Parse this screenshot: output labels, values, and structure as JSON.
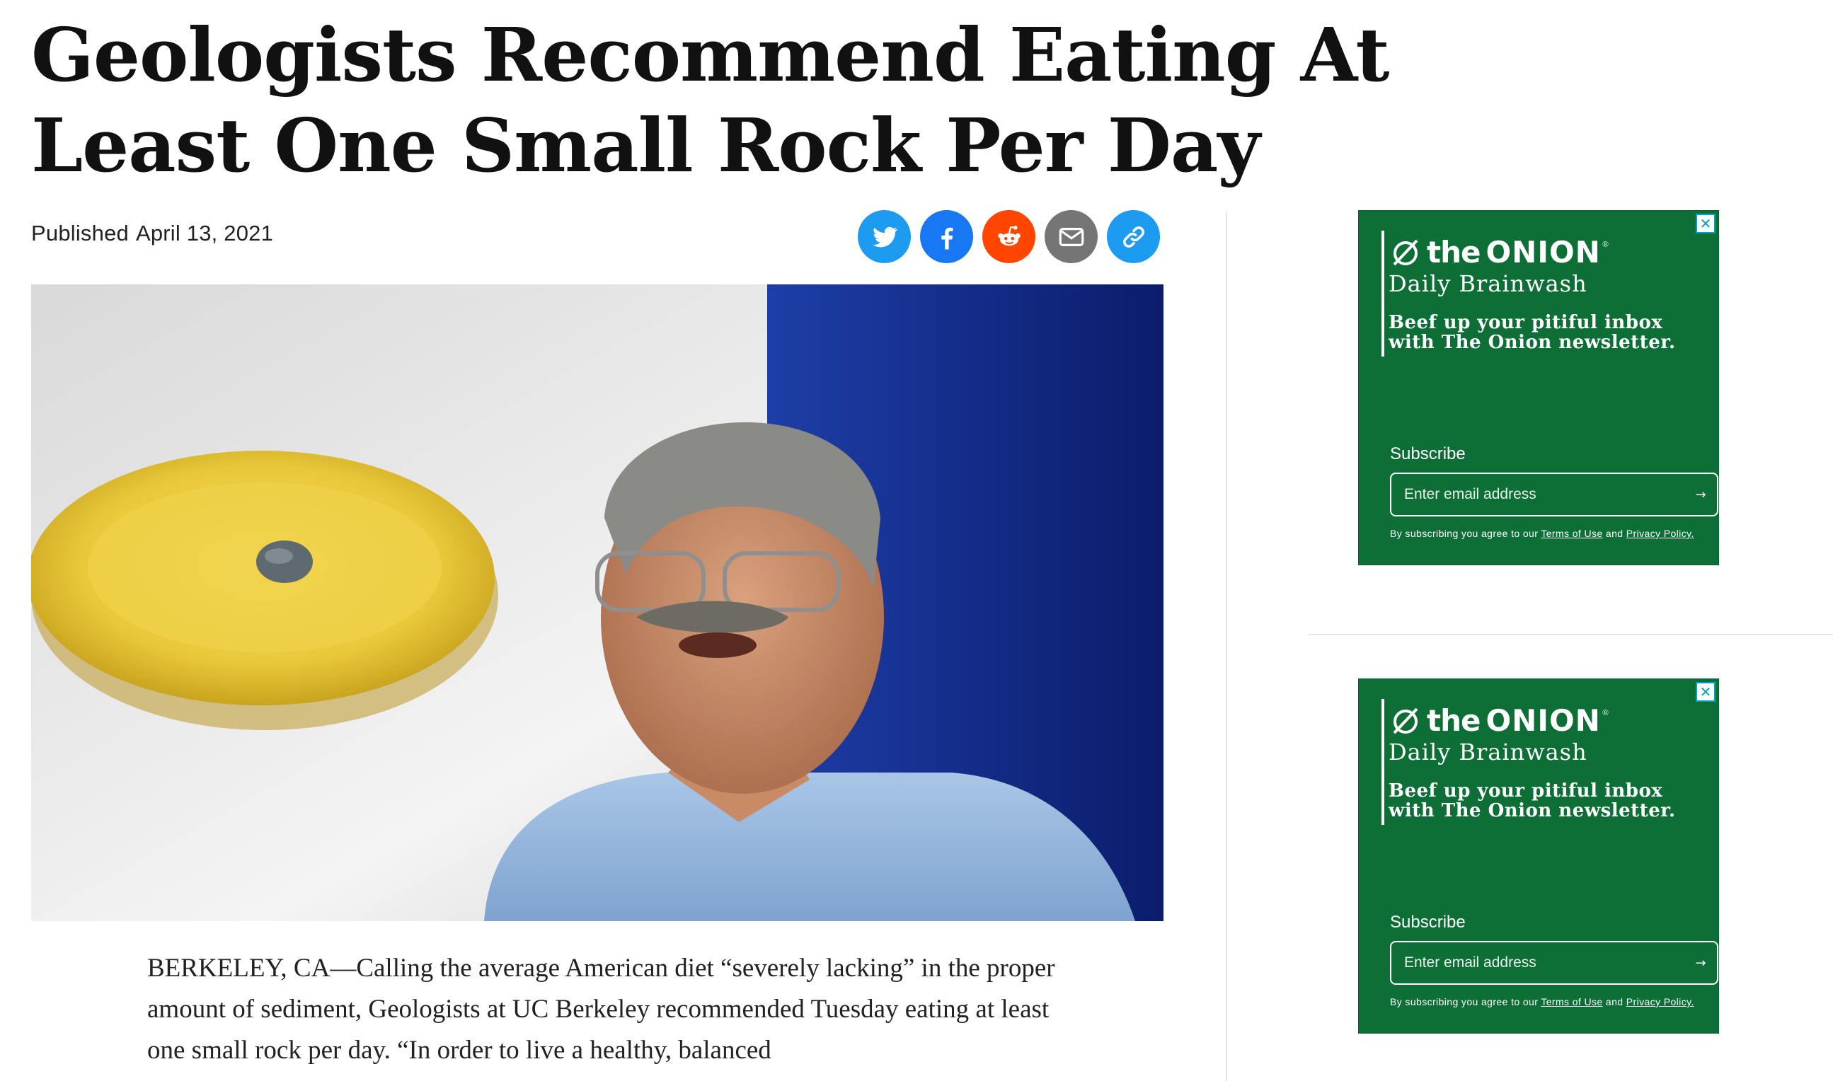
{
  "article": {
    "headline": "Geologists Recommend Eating At Least One Small Rock Per Day",
    "published_label": "Published",
    "published_date": "April 13, 2021",
    "body_paragraph": "BERKELEY, CA—Calling the average American diet “severely lacking” in the proper amount of sediment, Geologists at UC Berkeley recommended Tuesday eating at least one small rock per day. “In order to live a healthy, balanced"
  },
  "share": {
    "buttons": [
      {
        "icon": "twitter-icon",
        "color": "#1d9bf0"
      },
      {
        "icon": "facebook-icon",
        "color": "#1877f2"
      },
      {
        "icon": "reddit-icon",
        "color": "#ff4500"
      },
      {
        "icon": "email-icon",
        "color": "#757575"
      },
      {
        "icon": "link-icon",
        "color": "#1d9bf0"
      }
    ]
  },
  "newsletter_ads": [
    {
      "logo_the": "the",
      "logo_onion": "ONION",
      "logo_reg": "®",
      "brand": "Daily Brainwash",
      "pitch": "Beef up your pitiful inbox with The Onion newsletter.",
      "subscribe_label": "Subscribe",
      "email_placeholder": "Enter email address",
      "arrow": "→",
      "legal_prefix": "By subscribing you agree to our",
      "terms_link": "Terms of Use",
      "legal_and": "and",
      "privacy_link": "Privacy Policy.",
      "close": "✕"
    },
    {
      "logo_the": "the",
      "logo_onion": "ONION",
      "logo_reg": "®",
      "brand": "Daily Brainwash",
      "pitch": "Beef up your pitiful inbox with The Onion newsletter.",
      "subscribe_label": "Subscribe",
      "email_placeholder": "Enter email address",
      "arrow": "→",
      "legal_prefix": "By subscribing you agree to our",
      "terms_link": "Terms of Use",
      "legal_and": "and",
      "privacy_link": "Privacy Policy.",
      "close": "✕"
    }
  ],
  "colors": {
    "ad_green": "#0d6e36",
    "close_border": "#00a3c4"
  }
}
